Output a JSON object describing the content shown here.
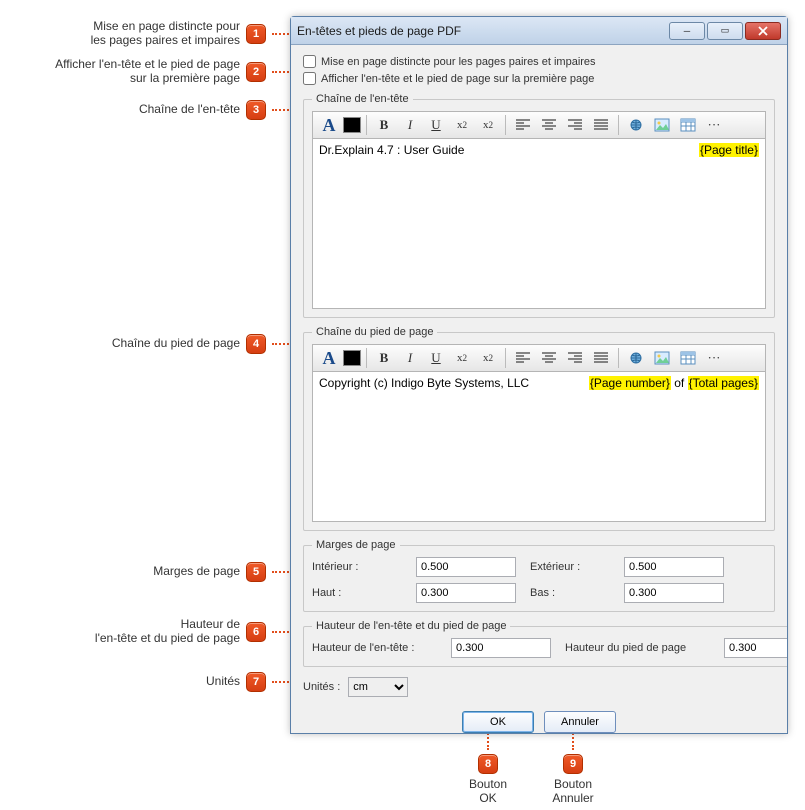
{
  "annotations": {
    "a1": "Mise en page distincte pour\nles pages paires et impaires",
    "a2": "Afficher l'en-tête et le pied de page\nsur la première page",
    "a3": "Chaîne de l'en-tête",
    "a4": "Chaîne du pied de page",
    "a5": "Marges de page",
    "a6": "Hauteur de\nl'en-tête et du pied de page",
    "a7": "Unités",
    "a8": "Bouton\nOK",
    "a9": "Bouton\nAnnuler"
  },
  "window": {
    "title": "En-têtes et pieds de page PDF"
  },
  "options": {
    "distinct_layout_label": "Mise en page distincte pour les pages paires et impaires",
    "show_on_first_page_label": "Afficher l'en-tête et le pied de page sur la première page"
  },
  "header_chain": {
    "legend": "Chaîne de l'en-tête",
    "left_text": "Dr.Explain 4.7 : User Guide",
    "right_placeholder": "{Page title}"
  },
  "footer_chain": {
    "legend": "Chaîne du pied de page",
    "left_text": "Copyright (c) Indigo Byte Systems, LLC",
    "right_ph1": "{Page number}",
    "right_mid": " of ",
    "right_ph2": "{Total pages}"
  },
  "margins": {
    "legend": "Marges de page",
    "interior_label": "Intérieur :",
    "interior_value": "0.500",
    "exterior_label": "Extérieur :",
    "exterior_value": "0.500",
    "top_label": "Haut :",
    "top_value": "0.300",
    "bottom_label": "Bas :",
    "bottom_value": "0.300"
  },
  "heights": {
    "legend": "Hauteur de l'en-tête et du pied de page",
    "header_label": "Hauteur de l'en-tête :",
    "header_value": "0.300",
    "footer_label": "Hauteur du pied de page",
    "footer_value": "0.300"
  },
  "units": {
    "label": "Unités :",
    "value": "cm"
  },
  "buttons": {
    "ok": "OK",
    "cancel": "Annuler"
  },
  "toolbar": {
    "font": "A",
    "bold": "B",
    "italic": "I",
    "underline": "U",
    "sub": "x",
    "sub2": "2",
    "sup": "x",
    "sup2": "2",
    "more": "···"
  }
}
